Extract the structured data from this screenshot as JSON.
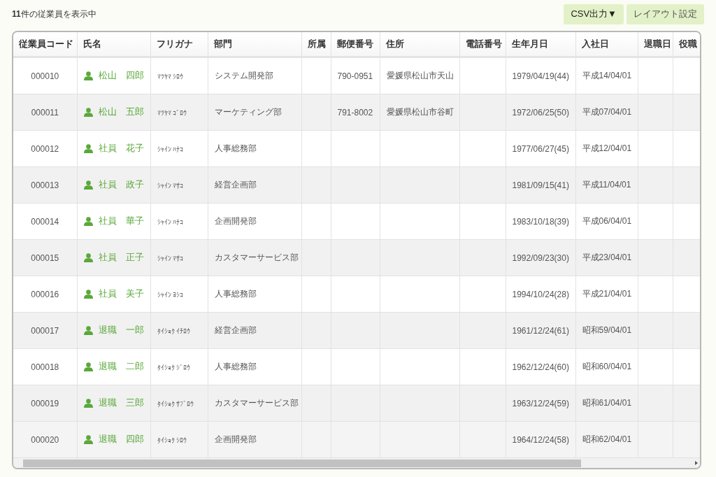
{
  "summary": "**11**件の従業員を表示中",
  "buttons": [
    {
      "label": "CSV出力▼"
    },
    {
      "label": "レイアウト設定"
    }
  ],
  "table": {
    "columns": [
      {
        "label": "従業員コード"
      },
      {
        "label": "氏名"
      },
      {
        "label": "フリガナ"
      },
      {
        "label": "部門"
      },
      {
        "label": "所属"
      },
      {
        "label": "郵便番号"
      },
      {
        "label": "住所"
      },
      {
        "label": "電話番号"
      },
      {
        "label": "生年月日"
      },
      {
        "label": "入社日"
      },
      {
        "label": "退職日"
      },
      {
        "label": "役職"
      }
    ],
    "rows": [
      {
        "code": "000010",
        "name": "松山　四郎",
        "furigana": "ﾏﾂﾔﾏ ｼﾛｳ",
        "department": "システム開発部",
        "postal_code": "790-0951",
        "address": "愛媛県松山市天山",
        "birth_date": "1979/04/19(44)",
        "hire_date": "平成14/04/01"
      },
      {
        "code": "000011",
        "name": "松山　五郎",
        "furigana": "ﾏﾂﾔﾏ ｺﾞﾛｳ",
        "department": "マーケティング部",
        "postal_code": "791-8002",
        "address": "愛媛県松山市谷町",
        "birth_date": "1972/06/25(50)",
        "hire_date": "平成07/04/01"
      },
      {
        "code": "000012",
        "name": "社員　花子",
        "furigana": "ｼｬｲﾝ ﾊﾅｺ",
        "department": "人事総務部",
        "birth_date": "1977/06/27(45)",
        "hire_date": "平成12/04/01"
      },
      {
        "code": "000013",
        "name": "社員　政子",
        "furigana": "ｼｬｲﾝ ﾏｻｺ",
        "department": "経営企画部",
        "birth_date": "1981/09/15(41)",
        "hire_date": "平成11/04/01"
      },
      {
        "code": "000014",
        "name": "社員　華子",
        "furigana": "ｼｬｲﾝ ﾊﾅｺ",
        "department": "企画開発部",
        "birth_date": "1983/10/18(39)",
        "hire_date": "平成06/04/01"
      },
      {
        "code": "000015",
        "name": "社員　正子",
        "furigana": "ｼｬｲﾝ ﾏｻｺ",
        "department": "カスタマーサービス部",
        "birth_date": "1992/09/23(30)",
        "hire_date": "平成23/04/01"
      },
      {
        "code": "000016",
        "name": "社員　美子",
        "furigana": "ｼｬｲﾝ ﾖｼｺ",
        "department": "人事総務部",
        "birth_date": "1994/10/24(28)",
        "hire_date": "平成21/04/01"
      },
      {
        "code": "000017",
        "name": "退職　一郎",
        "furigana": "ﾀｲｼｮｸ ｲﾁﾛｳ",
        "department": "経営企画部",
        "birth_date": "1961/12/24(61)",
        "hire_date": "昭和59/04/01"
      },
      {
        "code": "000018",
        "name": "退職　二郎",
        "furigana": "ﾀｲｼｮｸ ｼﾞﾛｳ",
        "department": "人事総務部",
        "birth_date": "1962/12/24(60)",
        "hire_date": "昭和60/04/01"
      },
      {
        "code": "000019",
        "name": "退職　三郎",
        "furigana": "ﾀｲｼｮｸ ｻﾌﾞﾛｳ",
        "department": "カスタマーサービス部",
        "birth_date": "1963/12/24(59)",
        "hire_date": "昭和61/04/01"
      },
      {
        "code": "000020",
        "name": "退職　四郎",
        "furigana": "ﾀｲｼｮｸ ｼﾛｳ",
        "department": "企画開発部",
        "birth_date": "1964/12/24(58)",
        "hire_date": "昭和62/04/01"
      }
    ]
  }
}
